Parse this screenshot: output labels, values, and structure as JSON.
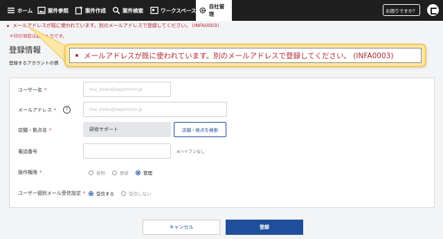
{
  "nav": {
    "items": [
      {
        "label": "ホーム",
        "icon": "menu-icon"
      },
      {
        "label": "案件参照",
        "icon": "image-icon"
      },
      {
        "label": "案件作成",
        "icon": "add-document-icon"
      },
      {
        "label": "案件検索",
        "icon": "search-icon"
      },
      {
        "label": "ワークスペース",
        "icon": "workspace-icon"
      },
      {
        "label": "自社管理",
        "icon": "gear-icon"
      }
    ],
    "active": "自社管理",
    "help_label": "お困りですか？"
  },
  "error_message": "メールアドレスが既に使われています。別のメールアドレスで登録してください。 (INFA0003)",
  "required_note": "＊印の項目は必須入力です。",
  "page_title": "登録情報",
  "page_subtitle": "登録するアカウントの情",
  "callout_message": "メールアドレスが既に使われています。別のメールアドレスで登録してください。 (INFA0003)",
  "form": {
    "username": {
      "label": "ユーザー名",
      "value": "mai_shoku@sagimimnr.jp"
    },
    "email": {
      "label": "メールアドレス",
      "value": "mai_shoku@sagimimnr.jp"
    },
    "store": {
      "label": "店舗・拠点名",
      "value": "研修サポート",
      "button": "店舗・拠点を検索"
    },
    "phone": {
      "label": "電話番号",
      "value": "",
      "hint": "※ハイフンなし"
    },
    "permission": {
      "label": "操作権限",
      "options": [
        "参照",
        "更新",
        "管理"
      ],
      "selected": "管理"
    },
    "mail_setting": {
      "label": "ユーザー個別メール受信設定",
      "options": [
        "受信する",
        "受信しない"
      ],
      "selected": "受信する"
    }
  },
  "buttons": {
    "cancel": "キャンセル",
    "submit": "登録"
  },
  "colors": {
    "accent": "#1f4e9a",
    "error": "#b3262e",
    "callout_bg": "#fde7a6"
  }
}
